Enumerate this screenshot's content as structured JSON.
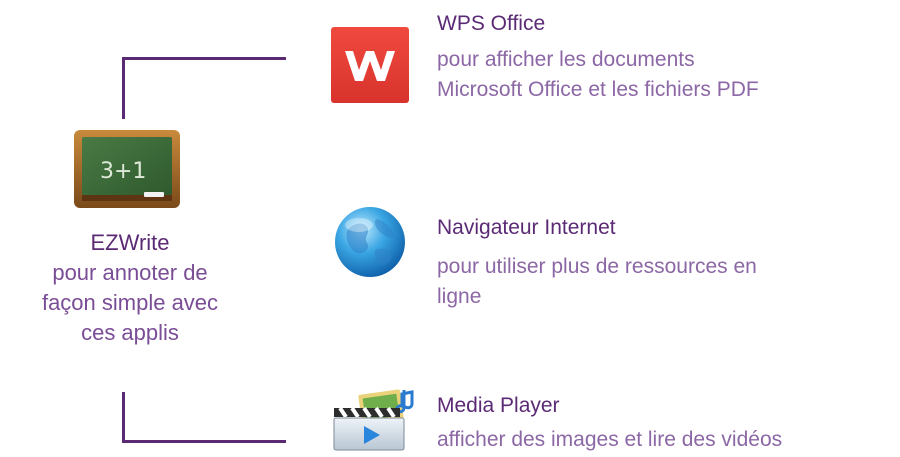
{
  "center": {
    "title": "EZWrite",
    "description": "pour annoter de\nfaçon simple avec\nces applis",
    "icon": "chalkboard-icon",
    "icon_text": "3+1"
  },
  "apps": [
    {
      "title": "WPS Office",
      "description": "pour afficher les documents\nMicrosoft Office et les fichiers PDF",
      "icon": "wps-office-icon"
    },
    {
      "title": "Navigateur Internet",
      "description": "pour utiliser plus de ressources en\nligne",
      "icon": "globe-icon"
    },
    {
      "title": "Media Player",
      "description": " afficher des images et lire des vidéos",
      "icon": "media-player-icon"
    }
  ],
  "colors": {
    "accent": "#5b2a75",
    "description": "#8c67a5",
    "wps_red": "#e8423b"
  }
}
